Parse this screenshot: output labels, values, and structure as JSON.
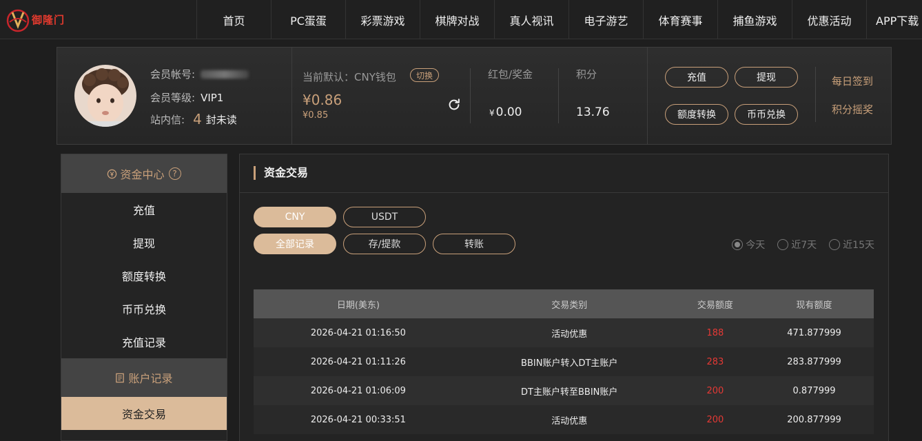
{
  "brand": {
    "name": "御隆门"
  },
  "nav": [
    "首页",
    "PC蛋蛋",
    "彩票游戏",
    "棋牌对战",
    "真人视讯",
    "电子游艺",
    "体育赛事",
    "捕鱼游戏",
    "优惠活动",
    "APP下载"
  ],
  "member": {
    "account_label": "会员帐号:",
    "level_label": "会员等级:",
    "level_value": "VIP1",
    "mail_label": "站内信:",
    "unread_count": "4",
    "unread_suffix": "封未读"
  },
  "wallet": {
    "label": "当前默认：CNY钱包",
    "switch": "切换",
    "balance": "¥0.86",
    "sub_balance": "¥0.85"
  },
  "stats": {
    "bonus_label": "红包/奖金",
    "bonus_currency": "¥",
    "bonus_value": "0.00",
    "points_label": "积分",
    "points_value": "13.76"
  },
  "actions": {
    "deposit": "充值",
    "withdraw": "提现",
    "transfer": "额度转换",
    "exchange": "币币兑换",
    "daily_checkin": "每日签到",
    "points_lottery": "积分摇奖"
  },
  "sidebar": {
    "section1": "资金中心",
    "section1_help": "?",
    "items": [
      "充值",
      "提现",
      "额度转换",
      "币币兑换",
      "充值记录"
    ],
    "section2": "账户记录",
    "active_item": "资金交易"
  },
  "main": {
    "title": "资金交易",
    "currencies": [
      "CNY",
      "USDT"
    ],
    "types": [
      "全部记录",
      "存/提款",
      "转账"
    ],
    "ranges": [
      "今天",
      "近7天",
      "近15天"
    ],
    "columns": [
      "日期(美东)",
      "交易类别",
      "交易额度",
      "现有额度"
    ],
    "rows": [
      [
        "2026-04-21 01:16:50",
        "活动优惠",
        "188",
        "471.877999"
      ],
      [
        "2026-04-21 01:11:26",
        "BBIN账户转入DT主账户",
        "283",
        "283.877999"
      ],
      [
        "2026-04-21 01:06:09",
        "DT主账户转至BBIN账户",
        "200",
        "0.877999"
      ],
      [
        "2026-04-21 00:33:51",
        "活动优惠",
        "200",
        "200.877999"
      ]
    ]
  },
  "colors": {
    "accent": "#c9a07a",
    "active_bg": "#dbbb9a",
    "amount": "#e53935"
  }
}
